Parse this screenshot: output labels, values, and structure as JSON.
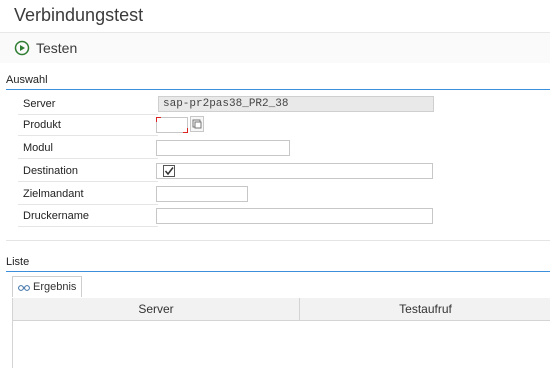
{
  "window": {
    "title": "Verbindungstest"
  },
  "toolbar": {
    "test_label": "Testen"
  },
  "auswahl": {
    "header": "Auswahl",
    "fields": {
      "server": {
        "label": "Server",
        "value": "sap-pr2pas38_PR2_38"
      },
      "produkt": {
        "label": "Produkt",
        "value": ""
      },
      "modul": {
        "label": "Modul",
        "value": ""
      },
      "destination": {
        "label": "Destination",
        "checked": true
      },
      "zielmandant": {
        "label": "Zielmandant",
        "value": ""
      },
      "druckername": {
        "label": "Druckername",
        "value": ""
      }
    }
  },
  "liste": {
    "header": "Liste",
    "tab": "Ergebnis",
    "columns": [
      "Server",
      "Testaufruf"
    ],
    "rows": []
  },
  "colors": {
    "accent_line": "#3b8fdc",
    "focus_corner": "#dd2222"
  }
}
